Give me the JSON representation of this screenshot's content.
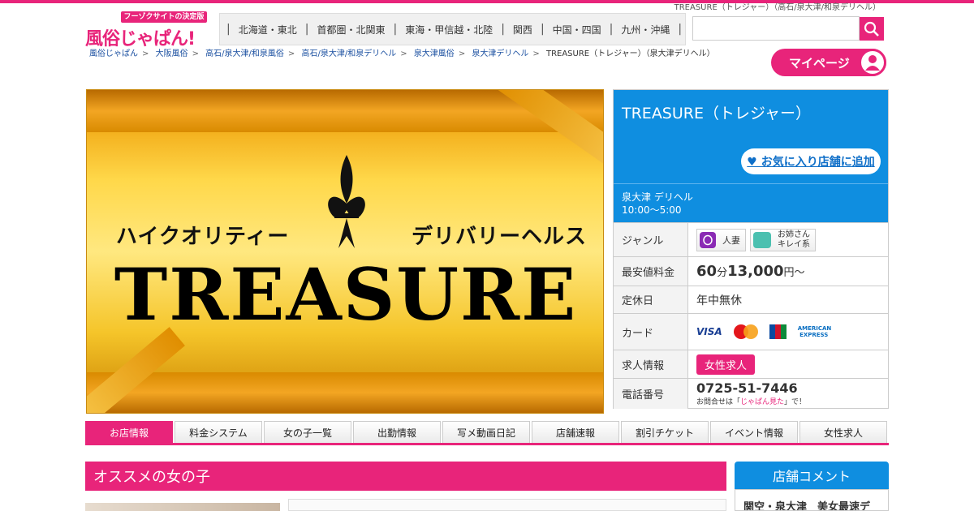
{
  "top_text": "TREASURE（トレジャー）（高石/泉大津/和泉デリヘル）",
  "logo": {
    "tag": "フーゾクサイトの決定版",
    "text": "風俗じゃぱん!"
  },
  "regions": [
    "北海道・東北",
    "首都圏・北関東",
    "東海・甲信越・北陸",
    "関西",
    "中国・四国",
    "九州・沖縄"
  ],
  "search": {
    "placeholder": ""
  },
  "breadcrumbs": [
    "風俗じゃぱん",
    "大阪風俗",
    "高石/泉大津/和泉風俗",
    "高石/泉大津/和泉デリヘル",
    "泉大津風俗",
    "泉大津デリヘル",
    "TREASURE（トレジャー）（泉大津デリヘル）"
  ],
  "mypage": "マイページ",
  "banner": {
    "sub_left": "ハイクオリティー",
    "sub_right": "デリバリーヘルス",
    "word": "TREASURE"
  },
  "shop": {
    "name": "TREASURE（トレジャー）",
    "fav": "♥ お気に入り店舗に追加",
    "area_type": "泉大津 デリヘル",
    "hours": "10:00～5:00",
    "rows": {
      "genre_label": "ジャンル",
      "genre1": "人妻",
      "genre2a": "お姉さん",
      "genre2b": "キレイ系",
      "price_label": "最安値料金",
      "price_min": "60",
      "price_min_unit": "分",
      "price_yen": "13,000",
      "price_yen_unit": "円～",
      "holiday_label": "定休日",
      "holiday": "年中無休",
      "card_label": "カード",
      "cards": [
        "VISA",
        "MasterCard",
        "JCB",
        "AMERICAN EXPRESS"
      ],
      "jobs_label": "求人情報",
      "jobs": "女性求人",
      "tel_label": "電話番号",
      "tel": "0725-51-7446",
      "tel_note_pre": "お問合せは「",
      "tel_note_em": "じゃぱん見た",
      "tel_note_post": "」で！"
    }
  },
  "tabs": [
    "お店情報",
    "料金システム",
    "女の子一覧",
    "出勤情報",
    "写メ動画日記",
    "店舗速報",
    "割引チケット",
    "イベント情報",
    "女性求人"
  ],
  "recommend_title": "オススメの女の子",
  "side": {
    "title": "店舗コメント",
    "body": "関空・泉大津　美女最速デ"
  },
  "colors": {
    "pink": "#e8247a",
    "blue": "#0f8ee0"
  }
}
